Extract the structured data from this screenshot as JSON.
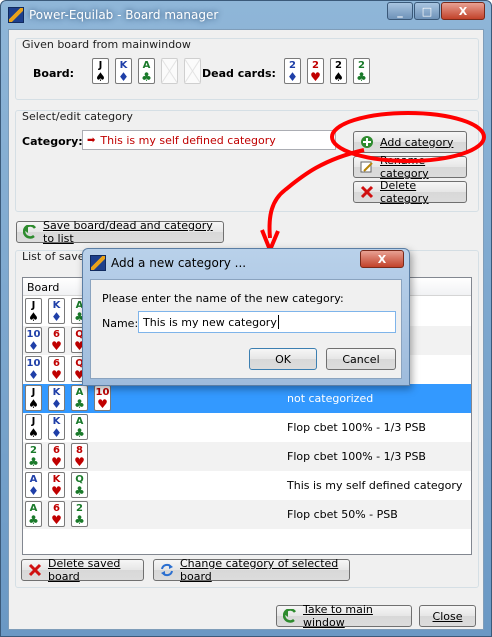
{
  "window": {
    "title": "Power-Equilab - Board manager",
    "controls": [
      "_",
      "□",
      "X"
    ]
  },
  "given_board": {
    "group_title": "Given board from mainwindow",
    "board_label": "Board:",
    "board_cards": [
      {
        "rank": "J",
        "suit": "♠",
        "color": "#000000"
      },
      {
        "rank": "K",
        "suit": "♦",
        "color": "#1f3fa8"
      },
      {
        "rank": "A",
        "suit": "♣",
        "color": "#1a7a2a"
      },
      {
        "rank": "",
        "suit": "",
        "color": ""
      },
      {
        "rank": "",
        "suit": "",
        "color": ""
      }
    ],
    "dead_cards_label": "Dead cards:",
    "dead_cards": [
      {
        "rank": "2",
        "suit": "♦",
        "color": "#1f3fa8"
      },
      {
        "rank": "2",
        "suit": "♥",
        "color": "#c00000"
      },
      {
        "rank": "2",
        "suit": "♠",
        "color": "#000000"
      },
      {
        "rank": "2",
        "suit": "♣",
        "color": "#1a7a2a"
      }
    ]
  },
  "category": {
    "group_title": "Select/edit category",
    "label": "Category:",
    "selected_value": "This is my self defined category",
    "add_button": "Add category",
    "rename_button": "Rename category",
    "delete_button": "Delete category"
  },
  "save_button": "Save board/dead and category to list",
  "saved_boards": {
    "group_title": "List of saved boards",
    "column_board": "Board",
    "rows": [
      {
        "cards": [
          {
            "rank": "J",
            "suit": "♠",
            "color": "#000000"
          },
          {
            "rank": "K",
            "suit": "♦",
            "color": "#1f3fa8"
          },
          {
            "rank": "A",
            "suit": "♣",
            "color": "#1a7a2a"
          }
        ],
        "category": "",
        "selected": false
      },
      {
        "cards": [
          {
            "rank": "10",
            "suit": "♦",
            "color": "#1f3fa8"
          },
          {
            "rank": "6",
            "suit": "♥",
            "color": "#c00000"
          },
          {
            "rank": "Q",
            "suit": "♥",
            "color": "#c00000"
          }
        ],
        "category": "",
        "selected": false
      },
      {
        "cards": [
          {
            "rank": "10",
            "suit": "♦",
            "color": "#1f3fa8"
          },
          {
            "rank": "6",
            "suit": "♥",
            "color": "#c00000"
          },
          {
            "rank": "Q",
            "suit": "♥",
            "color": "#c00000"
          }
        ],
        "category": "",
        "selected": false
      },
      {
        "cards": [
          {
            "rank": "J",
            "suit": "♠",
            "color": "#000000"
          },
          {
            "rank": "K",
            "suit": "♦",
            "color": "#1f3fa8"
          },
          {
            "rank": "A",
            "suit": "♣",
            "color": "#1a7a2a"
          },
          {
            "rank": "10",
            "suit": "♥",
            "color": "#c00000"
          }
        ],
        "category": "not categorized",
        "selected": true
      },
      {
        "cards": [
          {
            "rank": "J",
            "suit": "♠",
            "color": "#000000"
          },
          {
            "rank": "K",
            "suit": "♦",
            "color": "#1f3fa8"
          },
          {
            "rank": "A",
            "suit": "♣",
            "color": "#1a7a2a"
          }
        ],
        "category": "Flop cbet 100% - 1/3 PSB",
        "selected": false
      },
      {
        "cards": [
          {
            "rank": "2",
            "suit": "♣",
            "color": "#1a7a2a"
          },
          {
            "rank": "6",
            "suit": "♥",
            "color": "#c00000"
          },
          {
            "rank": "8",
            "suit": "♥",
            "color": "#c00000"
          }
        ],
        "category": "Flop cbet 100% - 1/3 PSB",
        "selected": false
      },
      {
        "cards": [
          {
            "rank": "A",
            "suit": "♦",
            "color": "#1f3fa8"
          },
          {
            "rank": "K",
            "suit": "♥",
            "color": "#c00000"
          },
          {
            "rank": "Q",
            "suit": "♣",
            "color": "#1a7a2a"
          }
        ],
        "category": "This is my self defined category",
        "selected": false
      },
      {
        "cards": [
          {
            "rank": "A",
            "suit": "♣",
            "color": "#1a7a2a"
          },
          {
            "rank": "6",
            "suit": "♥",
            "color": "#c00000"
          },
          {
            "rank": "2",
            "suit": "♣",
            "color": "#1a7a2a"
          }
        ],
        "category": "Flop cbet 50% - PSB",
        "selected": false
      }
    ]
  },
  "bottom_buttons": {
    "delete_saved": "Delete saved board",
    "change_category": "Change category of selected board",
    "to_main": "Take to main window",
    "close": "Close"
  },
  "dialog": {
    "title": "Add a new category ...",
    "prompt": "Please enter the name of the new category:",
    "name_label": "Name:",
    "name_value": "This is my new category",
    "ok": "OK",
    "cancel": "Cancel",
    "close_glyph": "X"
  },
  "colors": {
    "selection": "#3399ff",
    "category_text": "#c00000",
    "annotation": "#ff0000"
  }
}
